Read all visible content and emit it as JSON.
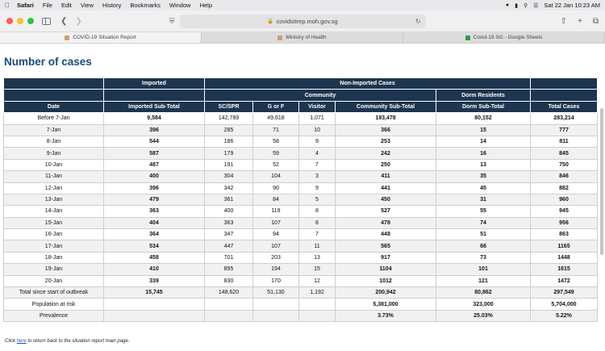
{
  "menubar": {
    "app": "Safari",
    "items": [
      "File",
      "Edit",
      "View",
      "History",
      "Bookmarks",
      "Window",
      "Help"
    ],
    "datetime": "Sat 22 Jan  10:23 AM"
  },
  "toolbar": {
    "url": "covidsitrep.moh.gov.sg"
  },
  "tabs": [
    {
      "label": "COVID-19 Situation Report",
      "active": true
    },
    {
      "label": "Ministry of Health",
      "active": false
    },
    {
      "label": "Covid-19 SG - Google Sheets",
      "active": false
    }
  ],
  "page": {
    "heading": "Number of cases",
    "header": {
      "imported": "Imported",
      "non_imported": "Non-Imported Cases",
      "community": "Community",
      "dorm": "Dorm Residents",
      "cols": [
        "Date",
        "Imported Sub-Total",
        "SC/SPR",
        "G or F",
        "Visitor",
        "Community Sub-Total",
        "Dorm Sub-Total",
        "Total Cases"
      ]
    },
    "rows": [
      [
        "Before 7-Jan",
        "9,584",
        "142,789",
        "49,618",
        "1,071",
        "193,478",
        "80,152",
        "283,214"
      ],
      [
        "7-Jan",
        "396",
        "285",
        "71",
        "10",
        "366",
        "15",
        "777"
      ],
      [
        "8-Jan",
        "544",
        "186",
        "58",
        "9",
        "253",
        "14",
        "811"
      ],
      [
        "9-Jan",
        "587",
        "179",
        "59",
        "4",
        "242",
        "16",
        "845"
      ],
      [
        "10-Jan",
        "487",
        "191",
        "52",
        "7",
        "250",
        "13",
        "750"
      ],
      [
        "11-Jan",
        "400",
        "304",
        "104",
        "3",
        "411",
        "35",
        "846"
      ],
      [
        "12-Jan",
        "396",
        "342",
        "90",
        "9",
        "441",
        "45",
        "882"
      ],
      [
        "13-Jan",
        "479",
        "361",
        "84",
        "5",
        "450",
        "31",
        "960"
      ],
      [
        "14-Jan",
        "363",
        "400",
        "119",
        "8",
        "527",
        "55",
        "945"
      ],
      [
        "15-Jan",
        "404",
        "363",
        "107",
        "8",
        "478",
        "74",
        "956"
      ],
      [
        "16-Jan",
        "364",
        "347",
        "94",
        "7",
        "448",
        "51",
        "863"
      ],
      [
        "17-Jan",
        "534",
        "447",
        "107",
        "11",
        "565",
        "66",
        "1165"
      ],
      [
        "18-Jan",
        "458",
        "701",
        "203",
        "13",
        "917",
        "73",
        "1448"
      ],
      [
        "19-Jan",
        "410",
        "895",
        "194",
        "15",
        "1104",
        "101",
        "1615"
      ],
      [
        "20-Jan",
        "339",
        "830",
        "170",
        "12",
        "1012",
        "121",
        "1472"
      ],
      [
        "Total since start of outbreak",
        "15,745",
        "148,620",
        "51,130",
        "1,192",
        "200,942",
        "80,862",
        "297,549"
      ],
      [
        "Population at risk",
        "",
        "",
        "",
        "",
        "5,381,000",
        "323,000",
        "5,704,000"
      ],
      [
        "Prevalence",
        "",
        "",
        "",
        "",
        "3.73%",
        "25.03%",
        "5.22%"
      ]
    ],
    "footer": {
      "prefix": "Click ",
      "link": "here",
      "suffix": " to return back to the situation report main page."
    }
  }
}
